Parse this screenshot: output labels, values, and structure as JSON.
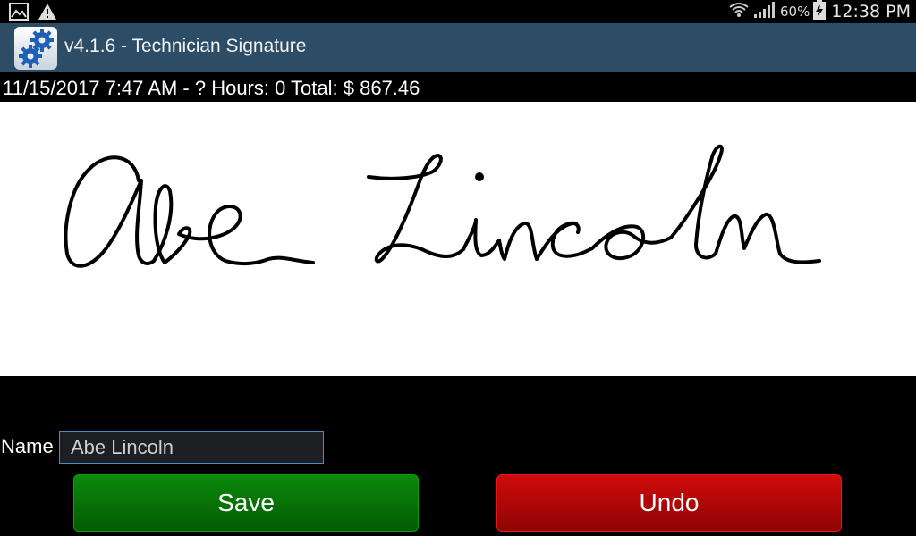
{
  "status_bar": {
    "battery_percent": "60%",
    "time": "12:38 PM",
    "icons": [
      "image-notification-icon",
      "warning-icon",
      "wifi-icon",
      "signal-icon",
      "battery-charging-icon"
    ]
  },
  "action_bar": {
    "title": "v4.1.6 - Technician Signature",
    "icon": "gears-app-icon"
  },
  "info_line": "11/15/2017 7:47 AM - ? Hours: 0 Total: $ 867.46",
  "signature": {
    "handwritten_text": "Abe Lincoln"
  },
  "form": {
    "name_label": "Name",
    "name_value": "Abe Lincoln"
  },
  "buttons": {
    "save_label": "Save",
    "undo_label": "Undo"
  },
  "colors": {
    "action_bar": "#2d4d66",
    "save": "#067a06",
    "undo": "#c00808",
    "field_border": "#4a8cc7"
  }
}
